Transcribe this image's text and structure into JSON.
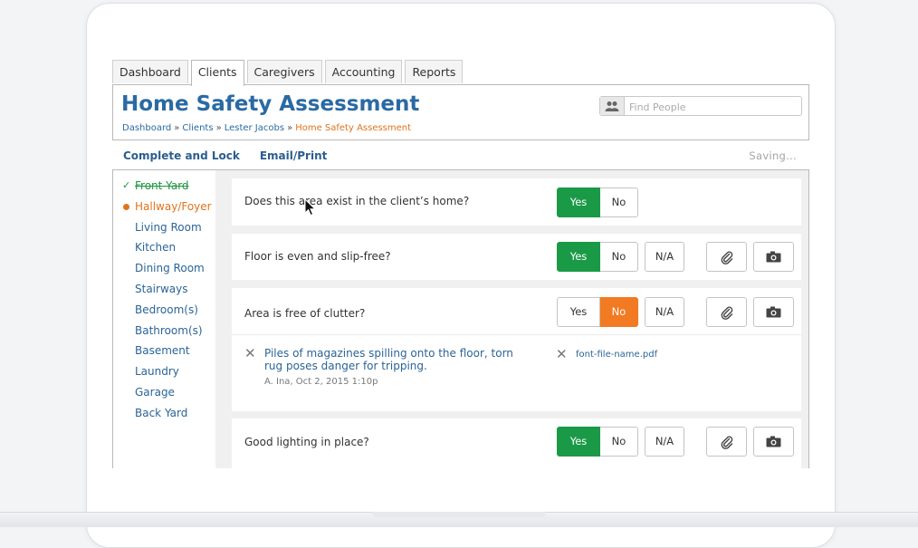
{
  "tabs": [
    "Dashboard",
    "Clients",
    "Caregivers",
    "Accounting",
    "Reports"
  ],
  "page_title": "Home Safety Assessment",
  "breadcrumb": {
    "items": [
      "Dashboard",
      "Clients",
      "Lester Jacobs"
    ],
    "current": "Home Safety Assessment",
    "separator": "»"
  },
  "search": {
    "placeholder": "Find People",
    "icon": "people-icon"
  },
  "actions": {
    "complete": "Complete and Lock",
    "email": "Email/Print"
  },
  "status": "Saving...",
  "rooms": [
    {
      "label": "Front Yard",
      "state": "done"
    },
    {
      "label": "Hallway/Foyer",
      "state": "active"
    },
    {
      "label": "Living Room"
    },
    {
      "label": "Kitchen"
    },
    {
      "label": "Dining Room"
    },
    {
      "label": "Stairways"
    },
    {
      "label": "Bedroom(s)"
    },
    {
      "label": "Bathroom(s)"
    },
    {
      "label": "Basement"
    },
    {
      "label": "Laundry"
    },
    {
      "label": "Garage"
    },
    {
      "label": "Back Yard"
    }
  ],
  "questions": [
    {
      "text": "Does this area exist in the client’s home?",
      "answer": "Yes",
      "has_na": false
    },
    {
      "text": "Floor is even and slip-free?",
      "answer": "Yes",
      "has_na": true
    },
    {
      "text": "Area is free of clutter?",
      "answer": "No",
      "has_na": true,
      "note": {
        "text": "Piles of magazines spilling onto the floor, torn rug poses danger for tripping.",
        "meta": "A. Ina, Oct 2, 2015 1:10p"
      },
      "attachment": "font-file-name.pdf"
    },
    {
      "text": "Good lighting in place?",
      "answer": "Yes",
      "has_na": true
    }
  ],
  "button_labels": {
    "yes": "Yes",
    "no": "No",
    "na": "N/A"
  },
  "colors": {
    "yes": "#1a9a46",
    "no": "#f27a22",
    "title": "#2a6aa3",
    "link": "#2b6497"
  }
}
